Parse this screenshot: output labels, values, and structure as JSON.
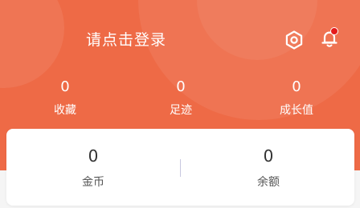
{
  "header": {
    "login_prompt": "请点击登录",
    "settings_icon": "settings-hexagon-icon",
    "bell_icon": "bell-icon",
    "has_notification": true,
    "background_color": "#ee6a46",
    "notification_dot_color": "#e51b1b"
  },
  "stats": [
    {
      "value": "0",
      "label": "收藏"
    },
    {
      "value": "0",
      "label": "足迹"
    },
    {
      "value": "0",
      "label": "成长值"
    }
  ],
  "wallet": [
    {
      "value": "0",
      "label": "金币"
    },
    {
      "value": "0",
      "label": "余额"
    }
  ]
}
